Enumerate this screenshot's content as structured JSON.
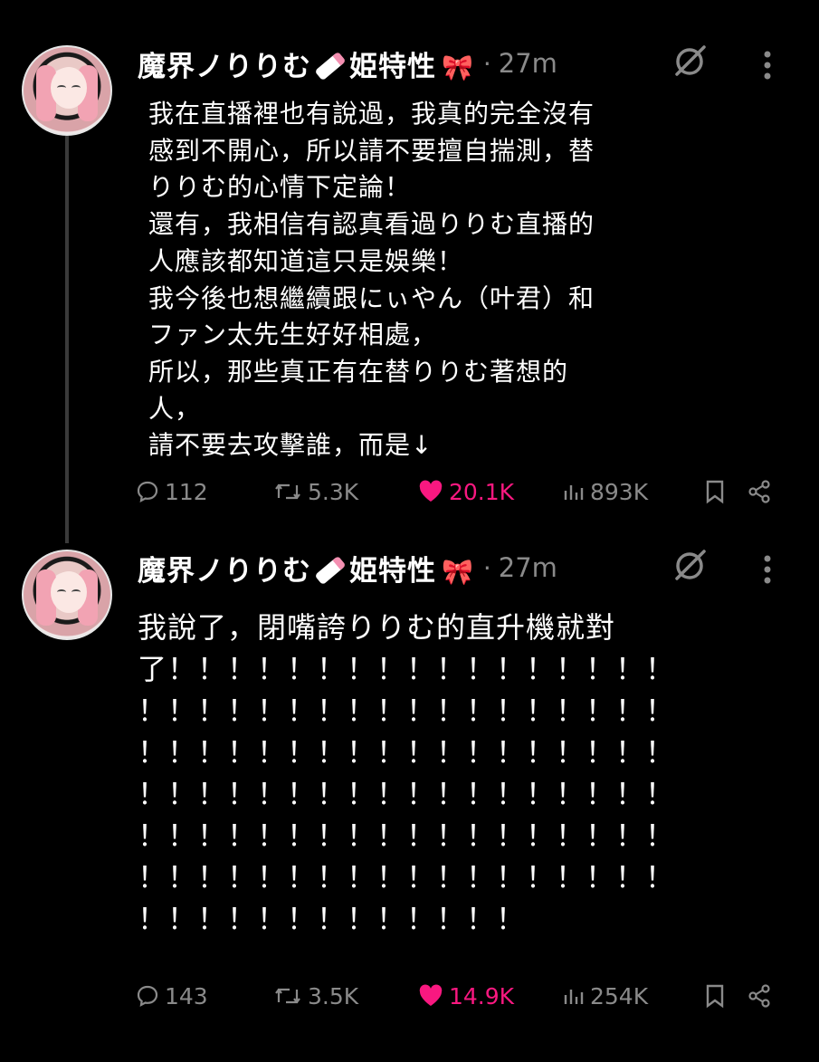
{
  "posts": [
    {
      "author": "魔界ノりりむ🍼姫特性🎀",
      "author_name": "魔界ノりりむ",
      "author_suffix": "姫特性",
      "separator": "·",
      "time": "27m",
      "text": "我在直播裡也有說過，我真的完全沒有\n感到不開心，所以請不要擅自揣測，替\nりりむ的心情下定論！\n還有，我相信有認真看過りりむ直播的\n人應該都知道這只是娛樂！\n我今後也想繼續跟にぃやん（叶君）和\nファン太先生好好相處，\n所以，那些真正有在替りりむ著想的\n人，\n請不要去攻擊誰，而是↓",
      "replies": "112",
      "reposts": "5.3K",
      "likes": "20.1K",
      "views": "893K"
    },
    {
      "author": "魔界ノりりむ🍼姫特性🎀",
      "author_name": "魔界ノりりむ",
      "author_suffix": "姫特性",
      "separator": "·",
      "time": "27m",
      "text": "我說了，閉嘴誇りりむ的直升機就對\n了！！！！！！！！！！！！！！！！！\n！！！！！！！！！！！！！！！！！！\n！！！！！！！！！！！！！！！！！！\n！！！！！！！！！！！！！！！！！！\n！！！！！！！！！！！！！！！！！！\n！！！！！！！！！！！！！！！！！！\n！！！！！！！！！！！！！",
      "replies": "143",
      "reposts": "3.5K",
      "likes": "14.9K",
      "views": "254K"
    }
  ],
  "icons": {
    "reply": "speech-bubble-icon",
    "repost": "repost-arrows-icon",
    "like": "heart-icon",
    "views": "bar-chart-icon",
    "bookmark": "bookmark-icon",
    "share": "share-icon",
    "grok": "slash-circle-icon",
    "more": "vertical-dots-icon"
  },
  "colors": {
    "background": "#000000",
    "muted": "#8a8a8a",
    "like": "#f91880"
  }
}
